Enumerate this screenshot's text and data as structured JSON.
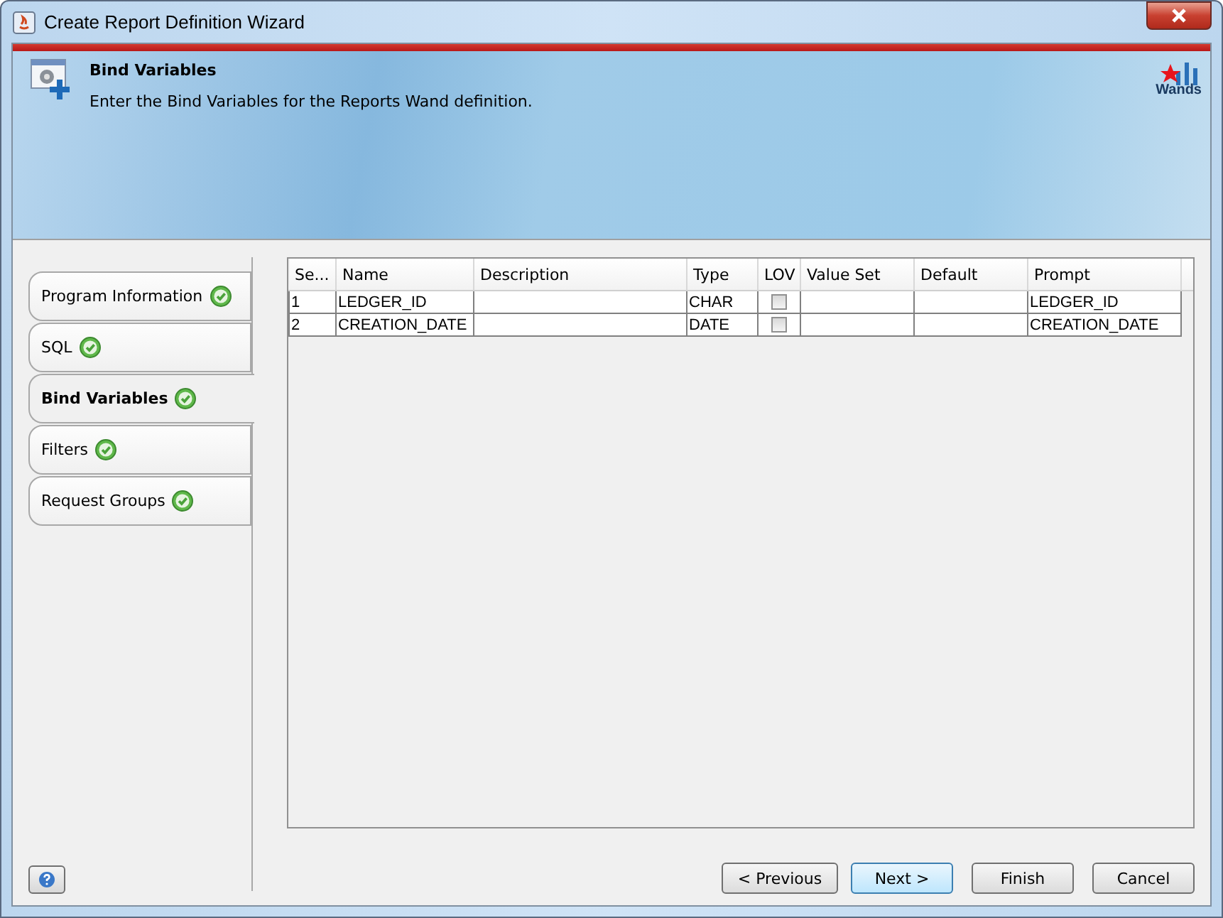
{
  "window": {
    "title": "Create Report Definition Wizard"
  },
  "header": {
    "title": "Bind Variables",
    "description": "Enter the Bind Variables for the Reports Wand definition.",
    "logo_text": "Wands"
  },
  "steps": [
    {
      "label": "Program Information",
      "selected": false,
      "complete": true
    },
    {
      "label": "SQL",
      "selected": false,
      "complete": true
    },
    {
      "label": "Bind Variables",
      "selected": true,
      "complete": true
    },
    {
      "label": "Filters",
      "selected": false,
      "complete": true
    },
    {
      "label": "Request Groups",
      "selected": false,
      "complete": true
    }
  ],
  "table": {
    "columns": [
      "Se...",
      "Name",
      "Description",
      "Type",
      "LOV",
      "Value Set",
      "Default",
      "Prompt"
    ],
    "rows": [
      {
        "seq": "1",
        "name": "LEDGER_ID",
        "description": "",
        "type": "CHAR",
        "lov": false,
        "value_set": "",
        "default": "",
        "prompt": "LEDGER_ID"
      },
      {
        "seq": "2",
        "name": "CREATION_DATE",
        "description": "",
        "type": "DATE",
        "lov": false,
        "value_set": "",
        "default": "",
        "prompt": "CREATION_DATE"
      }
    ]
  },
  "buttons": [
    {
      "label": "< Previous",
      "default": false
    },
    {
      "label": "Next >",
      "default": true
    },
    {
      "label": "Finish",
      "default": false
    },
    {
      "label": "Cancel",
      "default": false
    }
  ]
}
